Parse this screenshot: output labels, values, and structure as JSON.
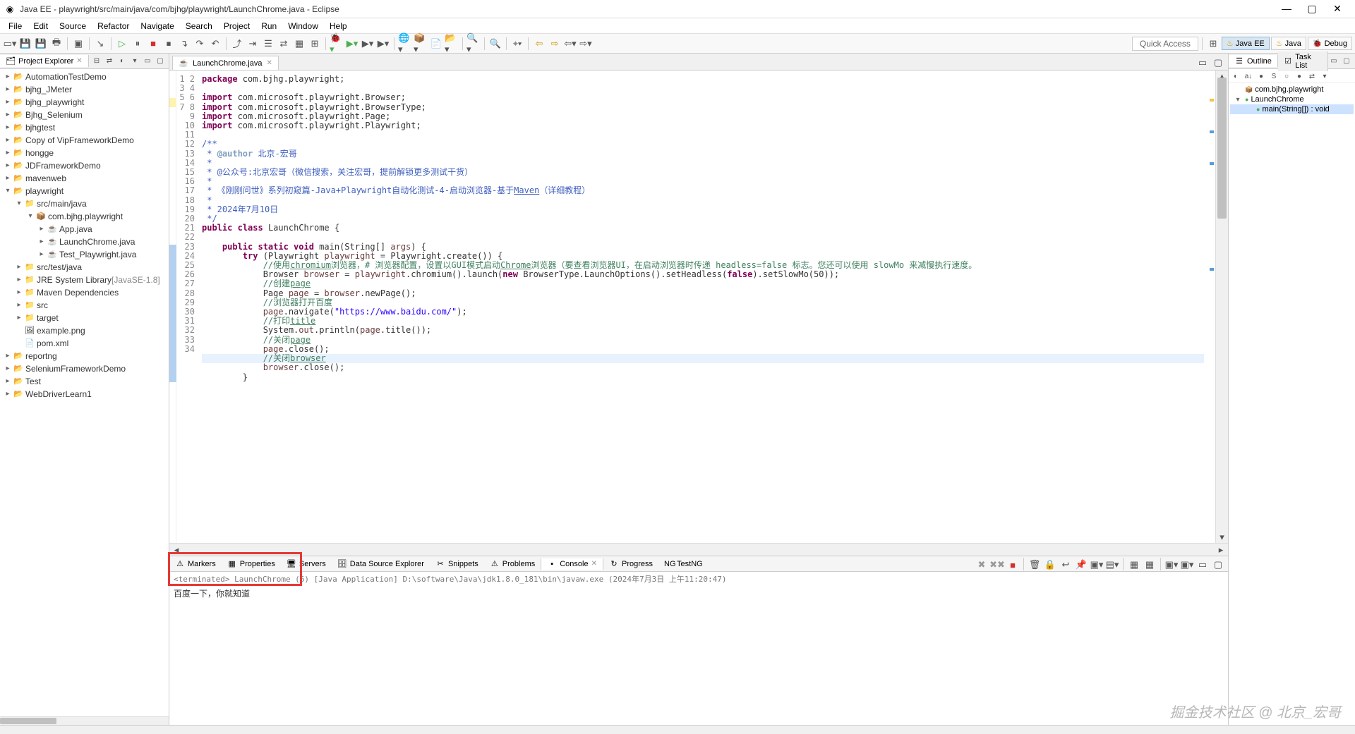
{
  "title": "Java EE - playwright/src/main/java/com/bjhg/playwright/LaunchChrome.java - Eclipse",
  "menu": [
    "File",
    "Edit",
    "Source",
    "Refactor",
    "Navigate",
    "Search",
    "Project",
    "Run",
    "Window",
    "Help"
  ],
  "quick_access": "Quick Access",
  "perspectives": [
    {
      "label": "Java EE",
      "active": true
    },
    {
      "label": "Java",
      "active": false
    },
    {
      "label": "Debug",
      "active": false
    }
  ],
  "project_explorer": {
    "title": "Project Explorer",
    "nodes": [
      {
        "label": "AutomationTestDemo",
        "icon": "proj",
        "expand": "▸",
        "indent": 0
      },
      {
        "label": "bjhg_JMeter",
        "icon": "proj",
        "expand": "▸",
        "indent": 0
      },
      {
        "label": "bjhg_playwright",
        "icon": "proj",
        "expand": "▸",
        "indent": 0
      },
      {
        "label": "Bjhg_Selenium",
        "icon": "proj",
        "expand": "▸",
        "indent": 0
      },
      {
        "label": "bjhgtest",
        "icon": "proj",
        "expand": "▸",
        "indent": 0
      },
      {
        "label": "Copy of VipFrameworkDemo",
        "icon": "proj",
        "expand": "▸",
        "indent": 0
      },
      {
        "label": "hongge",
        "icon": "proj",
        "expand": "▸",
        "indent": 0
      },
      {
        "label": "JDFrameworkDemo",
        "icon": "proj",
        "expand": "▸",
        "indent": 0
      },
      {
        "label": "mavenweb",
        "icon": "proj",
        "expand": "▸",
        "indent": 0
      },
      {
        "label": "playwright",
        "icon": "proj",
        "expand": "▾",
        "indent": 0
      },
      {
        "label": "src/main/java",
        "icon": "fold",
        "expand": "▾",
        "indent": 1
      },
      {
        "label": "com.bjhg.playwright",
        "icon": "pkg",
        "expand": "▾",
        "indent": 2
      },
      {
        "label": "App.java",
        "icon": "java",
        "expand": "▸",
        "indent": 3
      },
      {
        "label": "LaunchChrome.java",
        "icon": "java",
        "expand": "▸",
        "indent": 3
      },
      {
        "label": "Test_Playwright.java",
        "icon": "java",
        "expand": "▸",
        "indent": 3
      },
      {
        "label": "src/test/java",
        "icon": "fold",
        "expand": "▸",
        "indent": 1
      },
      {
        "label": "JRE System Library",
        "detail": "[JavaSE-1.8]",
        "icon": "fold",
        "expand": "▸",
        "indent": 1
      },
      {
        "label": "Maven Dependencies",
        "icon": "fold",
        "expand": "▸",
        "indent": 1
      },
      {
        "label": "src",
        "icon": "fold",
        "expand": "▸",
        "indent": 1
      },
      {
        "label": "target",
        "icon": "fold",
        "expand": "▸",
        "indent": 1
      },
      {
        "label": "example.png",
        "icon": "png",
        "expand": " ",
        "indent": 1
      },
      {
        "label": "pom.xml",
        "icon": "xml",
        "expand": " ",
        "indent": 1
      },
      {
        "label": "reportng",
        "icon": "proj",
        "expand": "▸",
        "indent": 0
      },
      {
        "label": "SeleniumFrameworkDemo",
        "icon": "proj",
        "expand": "▸",
        "indent": 0
      },
      {
        "label": "Test",
        "icon": "proj",
        "expand": "▸",
        "indent": 0
      },
      {
        "label": "WebDriverLearn1",
        "icon": "proj",
        "expand": "▸",
        "indent": 0
      }
    ]
  },
  "editor": {
    "tab_title": "LaunchChrome.java",
    "line_count": 34,
    "code_html": "<span class='kw'>package</span> com.bjhg.playwright;\n\n<span class='kw'>import</span> com.microsoft.playwright.Browser;\n<span class='kw'>import</span> com.microsoft.playwright.BrowserType;\n<span class='kw'>import</span> com.microsoft.playwright.Page;\n<span class='kw'>import</span> com.microsoft.playwright.Playwright;\n\n<span class='doc'>/**</span>\n<span class='doc'> * <span class='doctag'>@author</span> 北京-宏哥</span>\n<span class='doc'> *</span>\n<span class='doc'> * @公众号:北京宏哥（微信搜索，关注宏哥，提前解锁更多测试干货）</span>\n<span class='doc'> *</span>\n<span class='doc'> * 《刚刚问世》系列初窥篇-Java+Playwright自动化测试-4-启动浏览器-基于<u>Maven</u>（详细教程）</span>\n<span class='doc'> *</span>\n<span class='doc'> * 2024年7月10日</span>\n<span class='doc'> */</span>\n<span class='kw'>public</span> <span class='kw'>class</span> LaunchChrome {\n\n    <span class='kw'>public static void</span> main(String[] <span class='var'>args</span>) {\n        <span class='kw'>try</span> (Playwright <span class='var'>playwright</span> = Playwright.create()) {\n            <span class='cmt'>//使用<u>chromium</u>浏览器，# 浏览器配置，设置以GUI模式启动<u>Chrome</u>浏览器（要查看浏览器UI，在启动浏览器时传递 headless=false 标志。您还可以使用 slowMo 来减慢执行速度。</span>\n            Browser <span class='var'>browser</span> = <span class='var'>playwright</span>.chromium().launch(<span class='kw'>new</span> BrowserType.LaunchOptions().setHeadless(<span class='kw'>false</span>).setSlowMo(50));\n            <span class='cmt'>//创建<u>page</u></span>\n            Page <span class='var'>page</span> = <span class='var'>browser</span>.newPage();\n            <span class='cmt'>//浏览器打开百度</span>\n            <span class='var'>page</span>.navigate(<span class='str'>\"https://www.baidu.com/\"</span>);\n            <span class='cmt'>//打印<u>title</u></span>\n            System.<span class='var'>out</span>.println(<span class='var'>page</span>.title());\n            <span class='cmt'>//关闭<u>page</u></span>\n            <span class='var'>page</span>.close();\n<span class='line-highlight'>            <span class='cmt'>//关闭<u>browser</u></span></span>\n            <span class='var'>browser</span>.close();\n        }"
  },
  "bottom_tabs": [
    {
      "label": "Markers",
      "icon": "⚠"
    },
    {
      "label": "Properties",
      "icon": "▦"
    },
    {
      "label": "Servers",
      "icon": "🖥"
    },
    {
      "label": "Data Source Explorer",
      "icon": "🗄"
    },
    {
      "label": "Snippets",
      "icon": "✂"
    },
    {
      "label": "Problems",
      "icon": "⚠"
    },
    {
      "label": "Console",
      "icon": "▪",
      "active": true
    },
    {
      "label": "Progress",
      "icon": "↻"
    },
    {
      "label": "TestNG",
      "icon": "NG"
    }
  ],
  "console": {
    "header": "<terminated> LaunchChrome (6) [Java Application] D:\\software\\Java\\jdk1.8.0_181\\bin\\javaw.exe (2024年7月3日 上午11:20:47)",
    "output": "百度一下，你就知道"
  },
  "outline": {
    "title": "Outline",
    "task_list": "Task List",
    "nodes": [
      {
        "label": "com.bjhg.playwright",
        "icon": "📦",
        "indent": 0
      },
      {
        "label": "LaunchChrome",
        "icon": "●",
        "indent": 0,
        "expand": "▾",
        "color": "#4caf50"
      },
      {
        "label": "main(String[]) : void",
        "icon": "●",
        "indent": 1,
        "selected": true,
        "color": "#4caf50"
      }
    ]
  },
  "watermark": "掘金技术社区 @ 北京_宏哥"
}
